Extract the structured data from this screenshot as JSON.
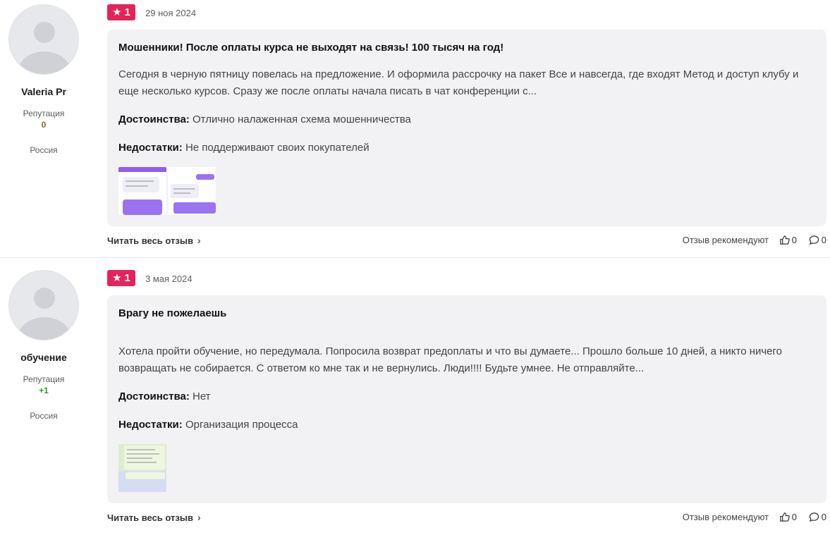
{
  "reviews": [
    {
      "author": {
        "name": "Valeria Pr",
        "reputation_label": "Репутация",
        "reputation_value": "0",
        "country": "Россия"
      },
      "rating": "1",
      "date": "29 ноя 2024",
      "title": "Мошенники! После оплаты курса не выходят на связь! 100 тысяч на год!",
      "text": "Сегодня в черную пятницу повелась на предложение. И оформила рассрочку на пакет Все и навсегда, где входят Метод и доступ клубу и еще несколько курсов. Сразу же после оплаты начала писать в чат конференции с...",
      "pros_label": "Достоинства:",
      "pros": "Отлично налаженная схема мошенничества",
      "cons_label": "Недостатки:",
      "cons": "Не поддерживают своих покупателей",
      "read_more": "Читать весь отзыв",
      "recommend_label": "Отзыв рекомендуют",
      "likes": "0",
      "comments": "0"
    },
    {
      "author": {
        "name": "обучение",
        "reputation_label": "Репутация",
        "reputation_value": "+1",
        "country": "Россия"
      },
      "rating": "1",
      "date": "3 мая 2024",
      "title": "Врагу не пожелаешь",
      "text": "Хотела пройти обучение, но передумала. Попросила возврат предоплаты и что вы думаете... Прошло больше 10 дней, а никто ничего возвращать не собирается. С ответом ко мне так и не вернулись. Люди!!!! Будьте умнее. Не отправляйте...",
      "pros_label": "Достоинства:",
      "pros": "Нет",
      "cons_label": "Недостатки:",
      "cons": "Организация процесса",
      "read_more": "Читать весь отзыв",
      "recommend_label": "Отзыв рекомендуют",
      "likes": "0",
      "comments": "0"
    }
  ],
  "colors": {
    "rating_badge": "#e3245a",
    "card_bg": "#f2f2f4",
    "reputation_positive": "#2e9a2e"
  },
  "icons": [
    "user-avatar-icon",
    "star-icon",
    "chevron-right-icon",
    "thumbs-up-icon",
    "comment-icon"
  ]
}
